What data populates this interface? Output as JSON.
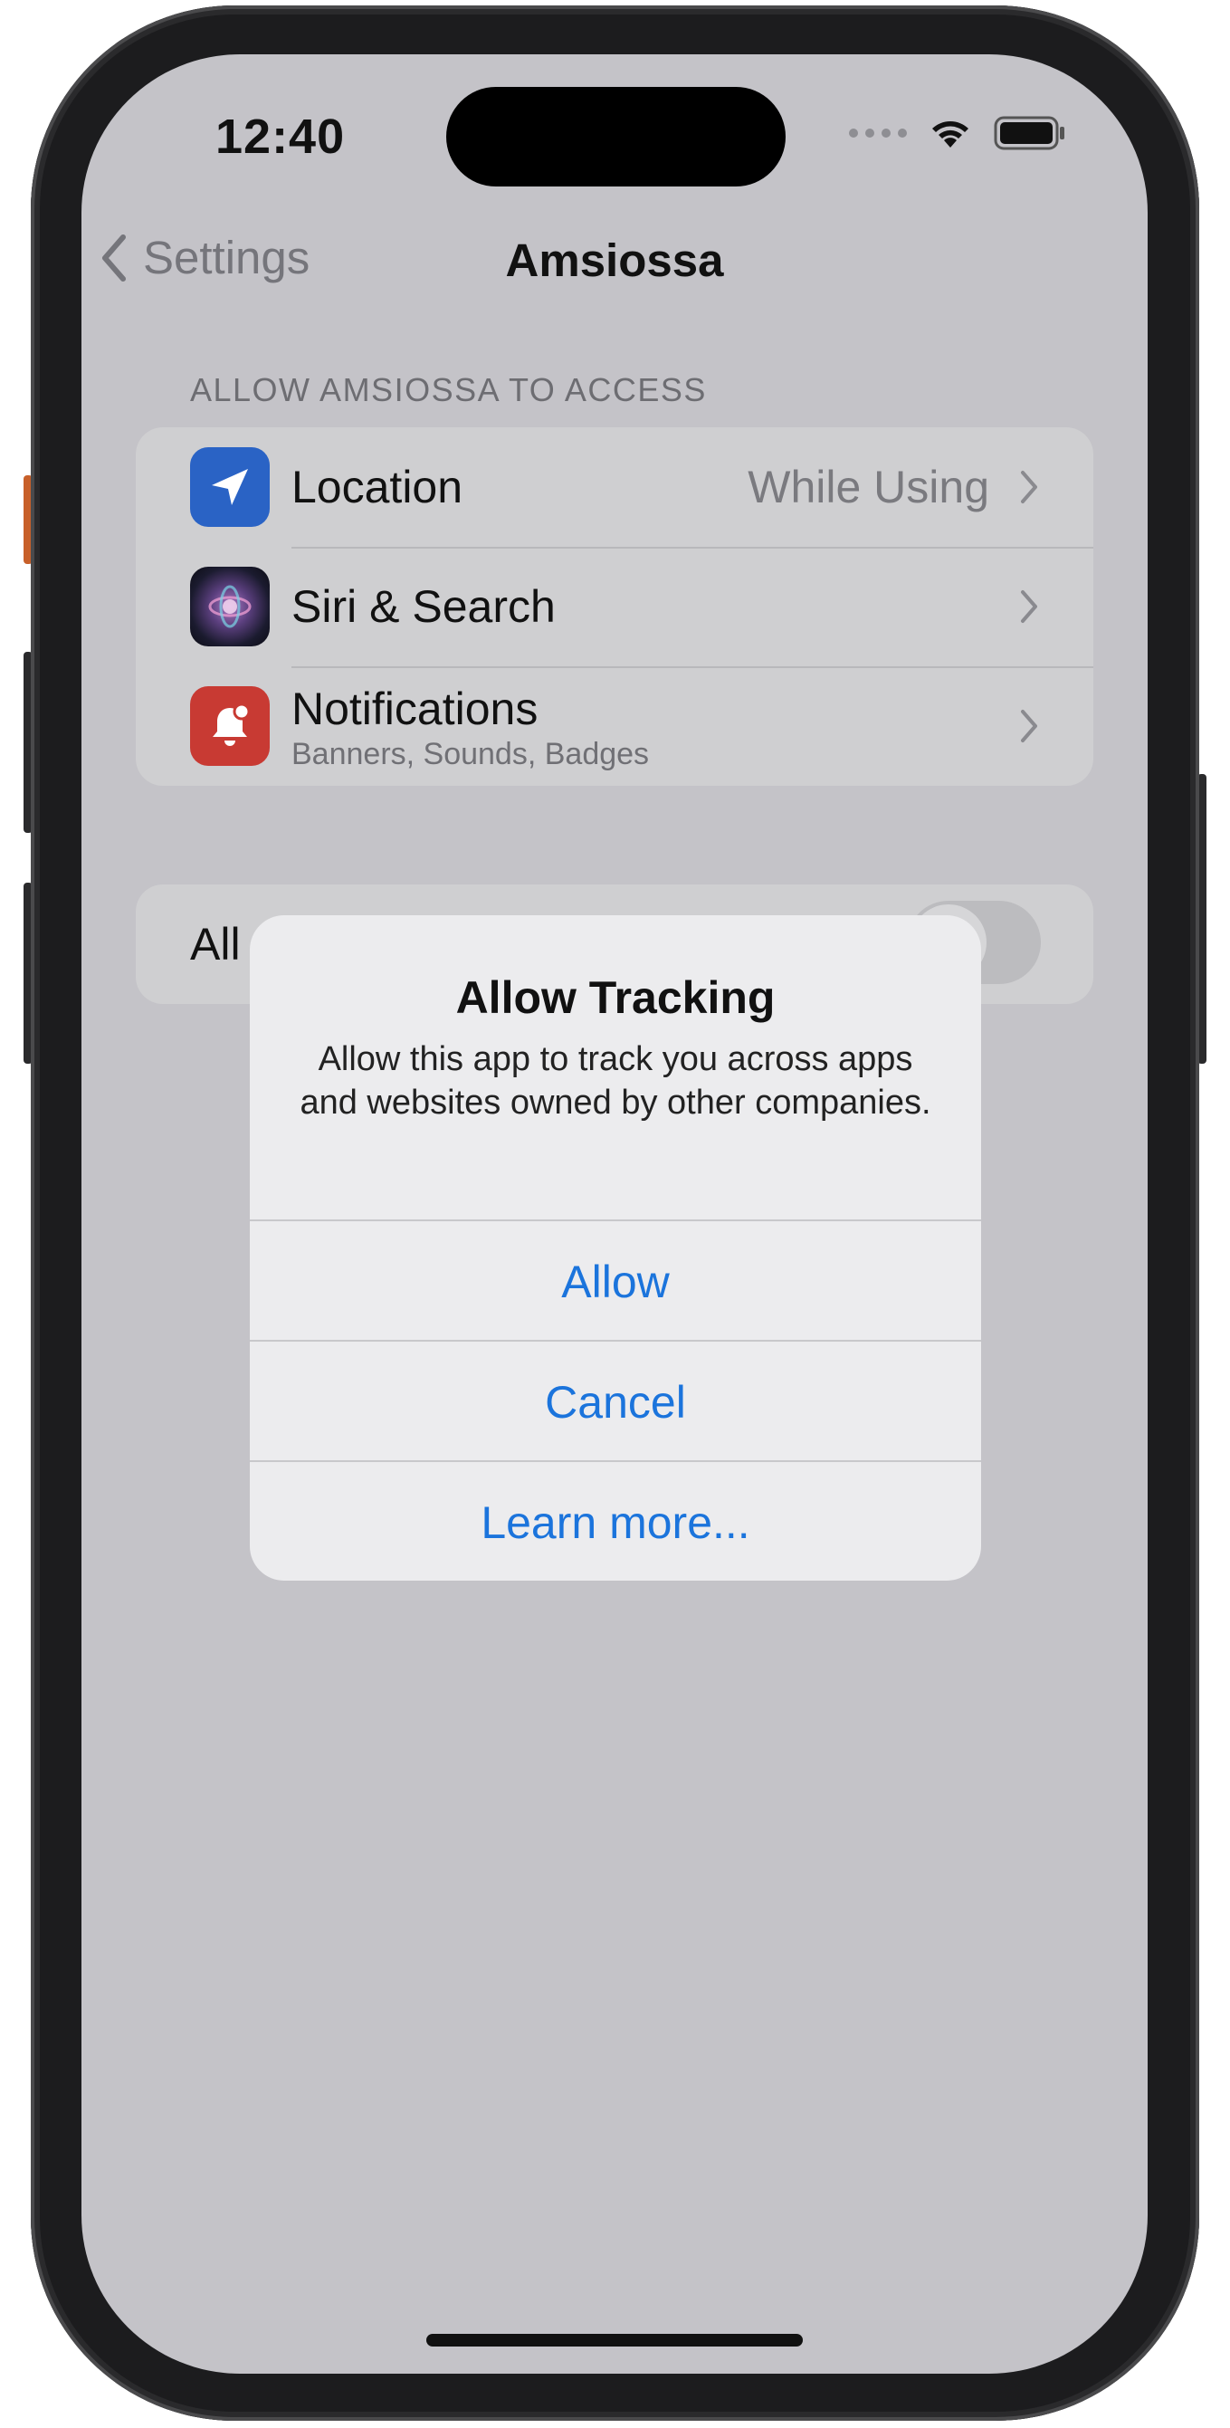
{
  "status_bar": {
    "time": "12:40"
  },
  "nav": {
    "back_label": "Settings",
    "title": "Amsiossa"
  },
  "section": {
    "header": "ALLOW AMSIOSSA TO ACCESS",
    "items": [
      {
        "label": "Location",
        "value": "While Using",
        "icon": "location-arrow-icon"
      },
      {
        "label": "Siri & Search",
        "icon": "siri-icon"
      },
      {
        "label": "Notifications",
        "sublabel": "Banners, Sounds, Badges",
        "icon": "notification-bell-icon"
      }
    ]
  },
  "tracking_row": {
    "label_visible": "All",
    "enabled": false
  },
  "alert": {
    "title": "Allow Tracking",
    "message": "Allow this app to track you across apps and websites owned by other companies.",
    "buttons": [
      "Allow",
      "Cancel",
      "Learn more..."
    ]
  },
  "colors": {
    "accent": "#1b74dc",
    "location_icon_bg": "#2a63c5",
    "notification_icon_bg": "#c83a33",
    "screen_dimmed_bg": "#c4c3c8"
  }
}
